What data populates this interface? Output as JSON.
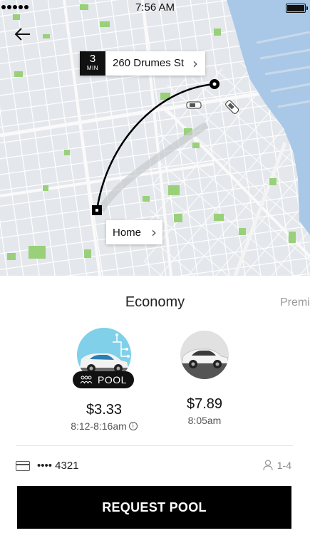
{
  "status_bar": {
    "time": "7:56 AM"
  },
  "map": {
    "pickup": {
      "eta_number": "3",
      "eta_unit": "MIN",
      "address": "260 Drumes St"
    },
    "destination": {
      "label": "Home"
    }
  },
  "categories": {
    "active": "Economy",
    "next": "Premi"
  },
  "options": [
    {
      "name": "POOL",
      "price": "$3.33",
      "time": "8:12-8:16am"
    },
    {
      "price": "$7.89",
      "time": "8:05am"
    }
  ],
  "payment": {
    "card": "•••• 4321"
  },
  "seats": {
    "label": "1-4"
  },
  "request_button": {
    "label": "REQUEST POOL"
  },
  "colors": {
    "water": "#a9c8e8",
    "park": "#9ad07a",
    "pool_bg": "#7fd0e8",
    "button": "#000000"
  }
}
